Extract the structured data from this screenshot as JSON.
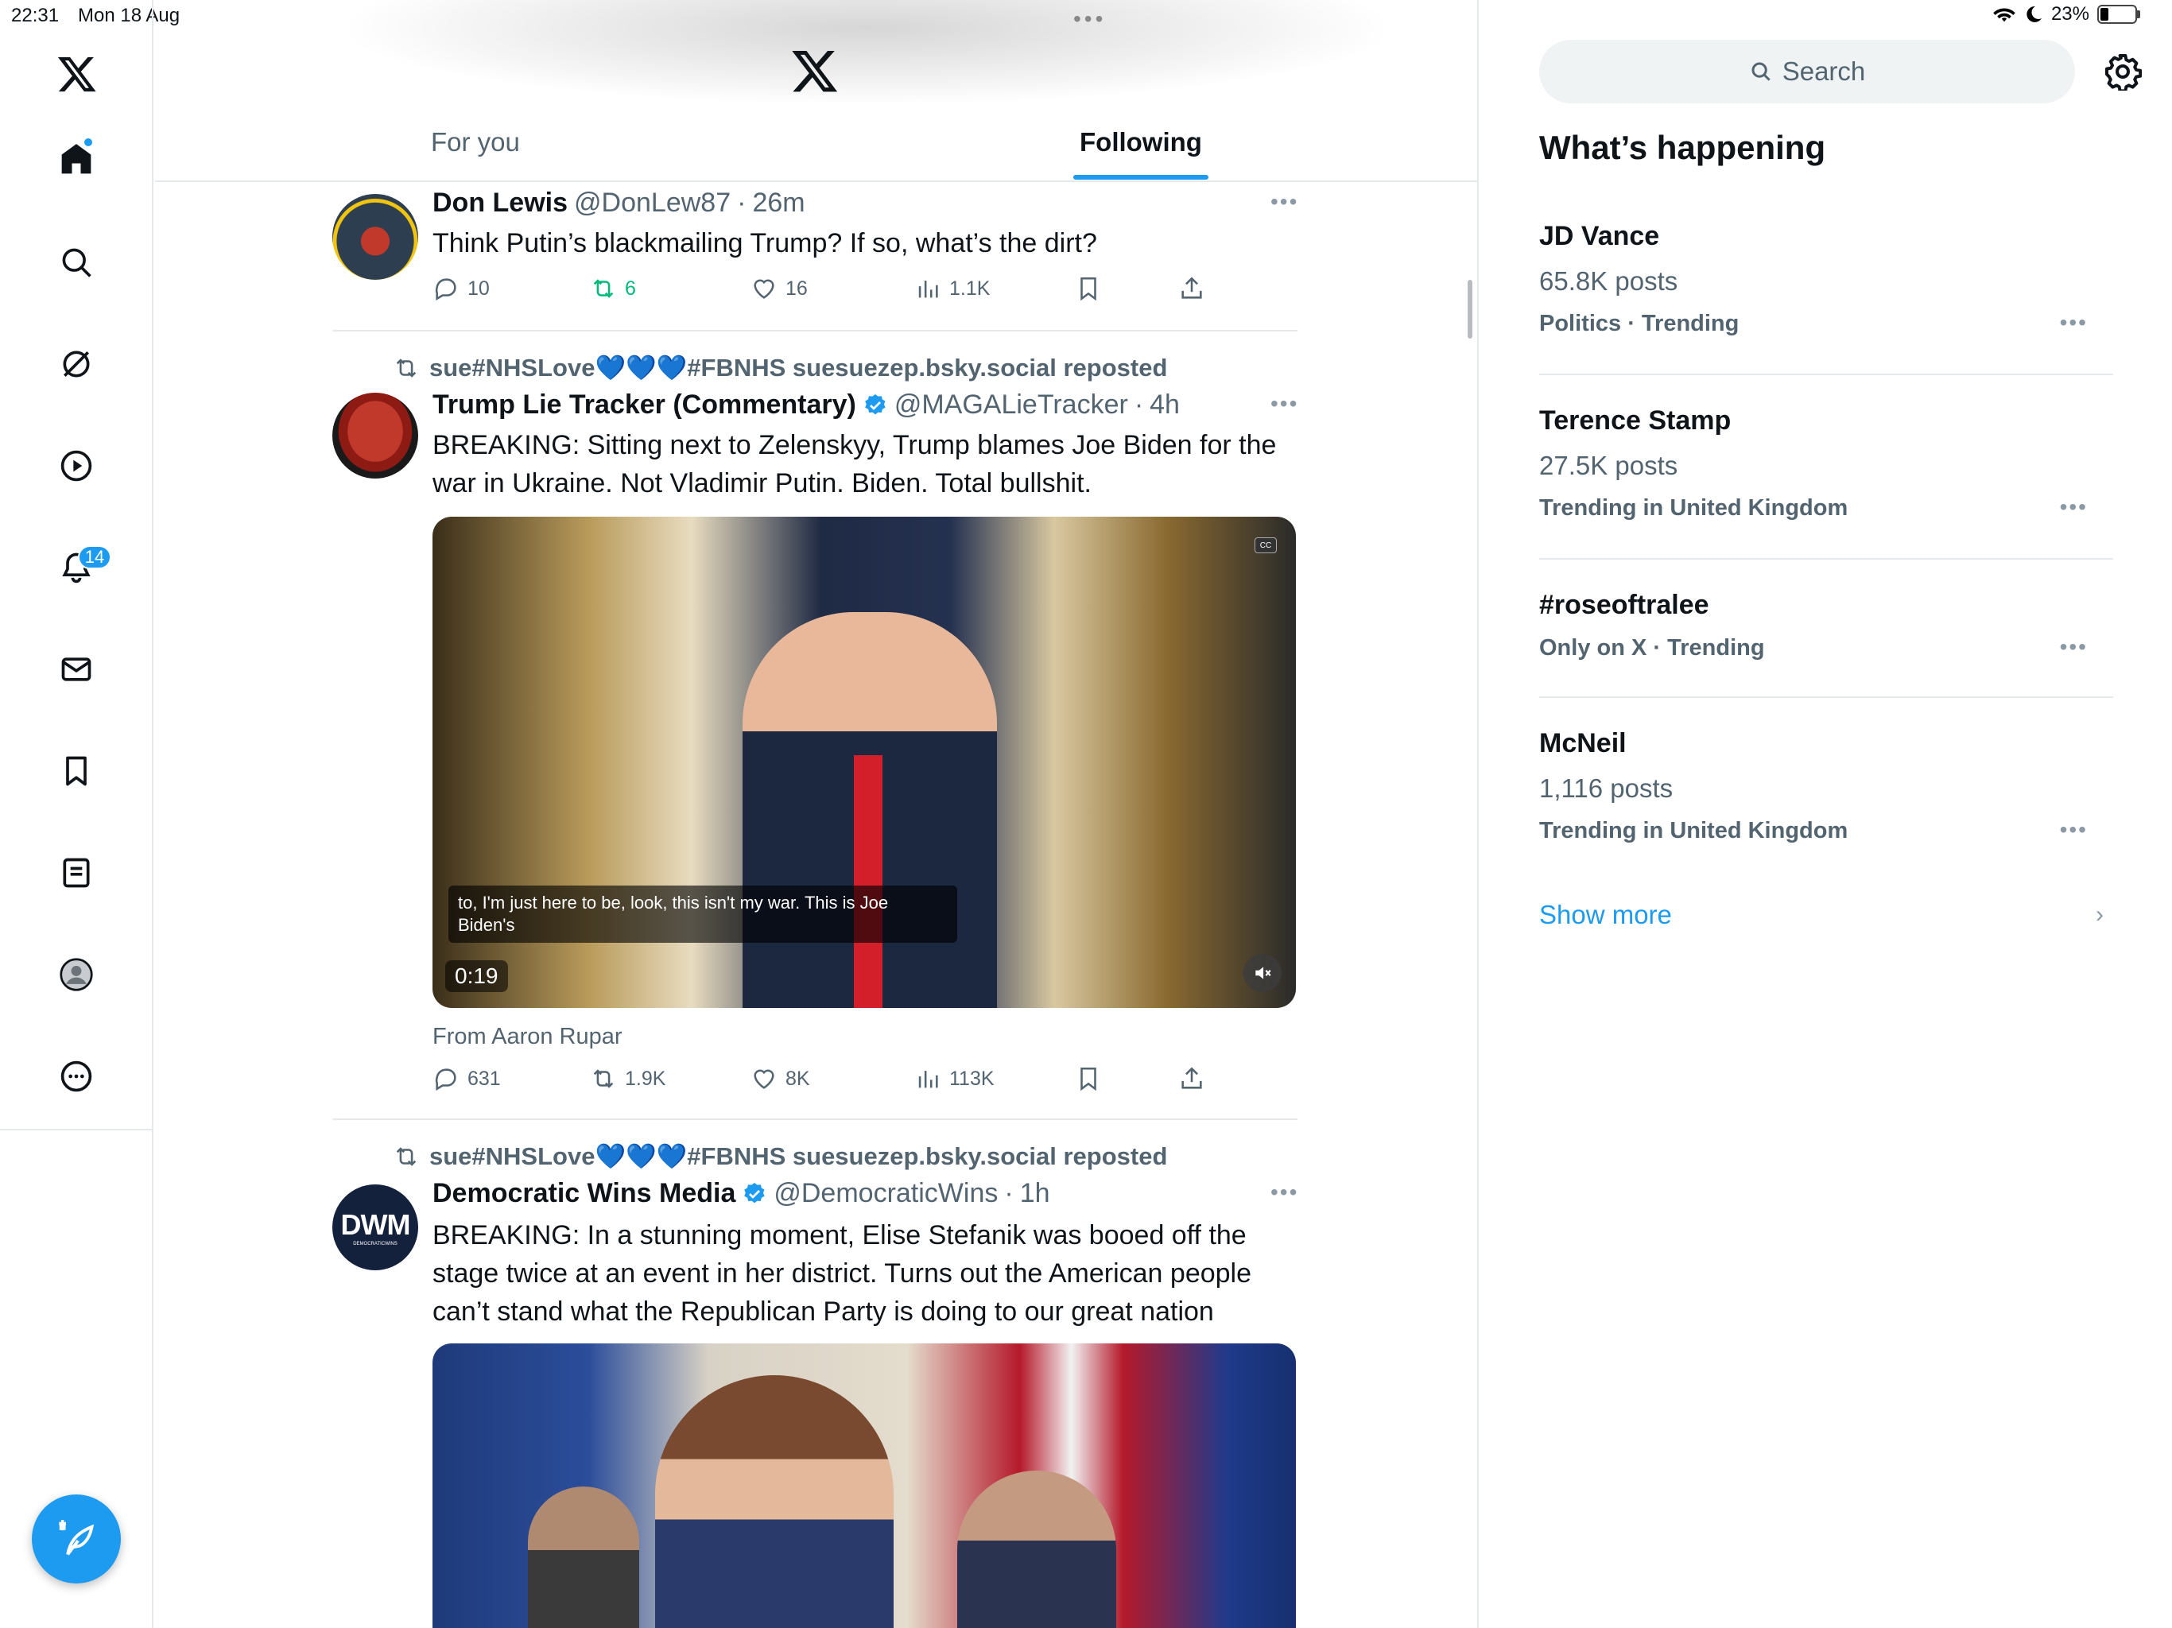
{
  "status_bar": {
    "time": "22:31",
    "date": "Mon 18 Aug",
    "battery": "23%",
    "battery_level": 0.23
  },
  "nav": {
    "notifications_badge": "14",
    "items": [
      "home",
      "search",
      "grok",
      "video",
      "notifications",
      "messages",
      "bookmarks",
      "lists",
      "profile",
      "more"
    ]
  },
  "header": {
    "dots": "•••",
    "tabs": [
      {
        "label": "For you",
        "active": false
      },
      {
        "label": "Following",
        "active": true
      }
    ]
  },
  "tweets": [
    {
      "name": "Don Lewis",
      "handle": "@DonLew87",
      "time": "26m",
      "text": "Think Putin’s blackmailing Trump? If so, what’s the dirt?",
      "replies": "10",
      "reposts": "6",
      "likes": "16",
      "views": "1.1K",
      "reposted_by_me": true
    },
    {
      "repost_by": "sue#NHSLove",
      "repost_hearts": "💙💙💙",
      "repost_suffix": "#FBNHS suesuezep.bsky.social reposted",
      "name": "Trump Lie Tracker (Commentary)",
      "verified": true,
      "handle": "@MAGALieTracker",
      "time": "4h",
      "text": "BREAKING: Sitting next to Zelenskyy, Trump blames Joe Biden for the war in Ukraine. Not Vladimir Putin. Biden. Total bullshit.",
      "video": {
        "caption": "to, I'm just here to be, look, this isn't my war. This is Joe Biden's",
        "duration": "0:19",
        "cc": "CC"
      },
      "from": "From Aaron Rupar",
      "replies": "631",
      "reposts": "1.9K",
      "likes": "8K",
      "views": "113K"
    },
    {
      "repost_by": "sue#NHSLove",
      "repost_hearts": "💙💙💙",
      "repost_suffix": "#FBNHS suesuezep.bsky.social reposted",
      "name": "Democratic Wins Media",
      "verified": true,
      "handle": "@DemocraticWins",
      "time": "1h",
      "avatar_text": "DWM",
      "avatar_subtext": "DEMOCRATICWINS",
      "text": "BREAKING: In a stunning moment, Elise Stefanik was booed off the stage twice at an event in her district. Turns out the American people can’t stand what the Republican Party is doing to our great nation"
    }
  ],
  "sidebar": {
    "search_placeholder": "Search",
    "title": "What’s happening",
    "trends": [
      {
        "name": "JD Vance",
        "count": "65.8K posts",
        "meta": "Politics · Trending"
      },
      {
        "name": "Terence Stamp",
        "count": "27.5K posts",
        "meta": "Trending in United Kingdom"
      },
      {
        "name": "#roseoftralee",
        "count": "",
        "meta": "Only on X · Trending"
      },
      {
        "name": "McNeil",
        "count": "1,116 posts",
        "meta": "Trending in United Kingdom"
      }
    ],
    "show_more": "Show more"
  },
  "colors": {
    "accent": "#1d9bf0",
    "repost_green": "#00ba7c",
    "muted": "#536471",
    "text": "#0f1419"
  }
}
